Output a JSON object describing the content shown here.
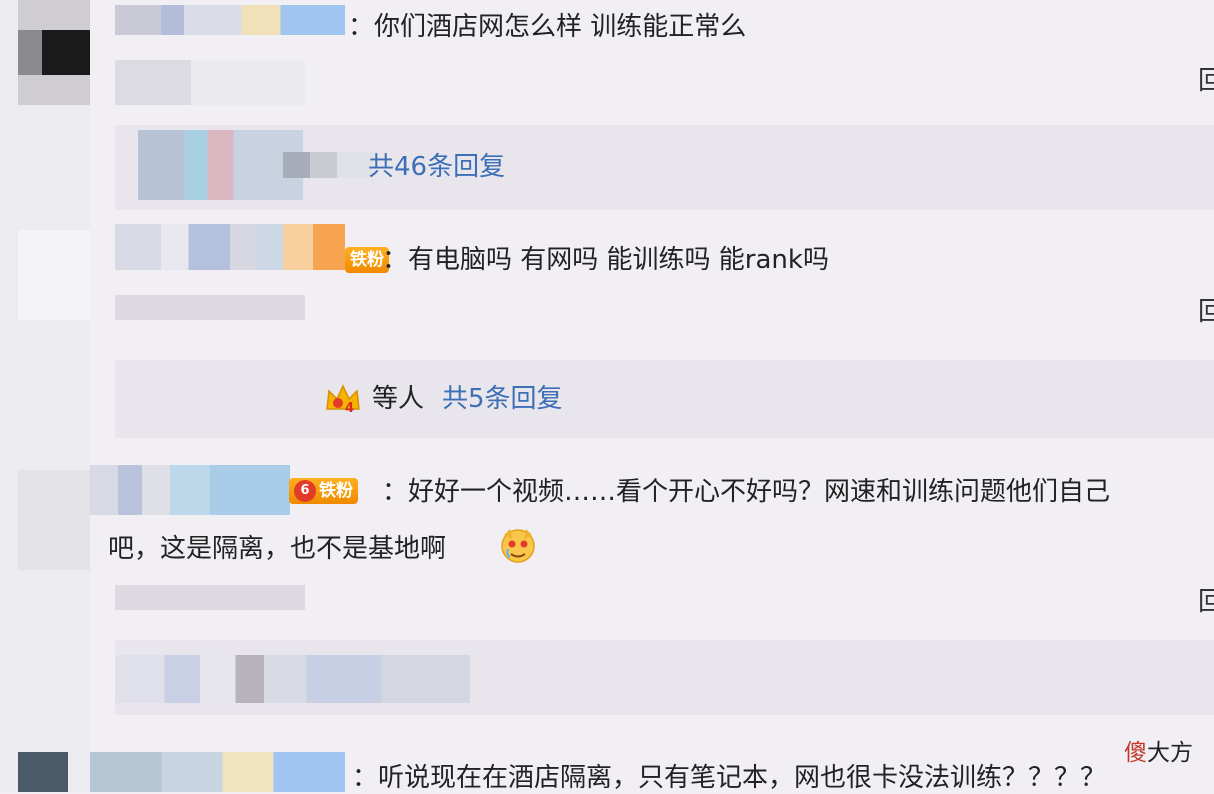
{
  "comments": [
    {
      "text": "：你们酒店网怎么样 训练能正常么",
      "reply_button": "回",
      "replies_summary": "共46条回复"
    },
    {
      "badge": "铁粉",
      "text": "：有电脑吗 有网吗 能训练吗 能rank吗",
      "reply_button": "回",
      "replies_prefix": "等人",
      "replies_summary": "共5条回复",
      "crown_level": "4"
    },
    {
      "badge": "铁粉",
      "badge_level": "6",
      "text_line1": "：好好一个视频……看个开心不好吗？网速和训练问题他们自己",
      "text_line2": "吧，这是隔离，也不是基地啊",
      "reply_button": "回"
    },
    {
      "text": "：听说现在在酒店隔离，只有笔记本，网也很卡没法训练？？？？"
    }
  ],
  "watermark": {
    "char1": "傻",
    "rest": "大方"
  },
  "colors": {
    "background": "#f1eff3",
    "link_blue": "#3d6fb6",
    "badge_orange": "#f6a000",
    "watermark_red": "#c0392b"
  }
}
